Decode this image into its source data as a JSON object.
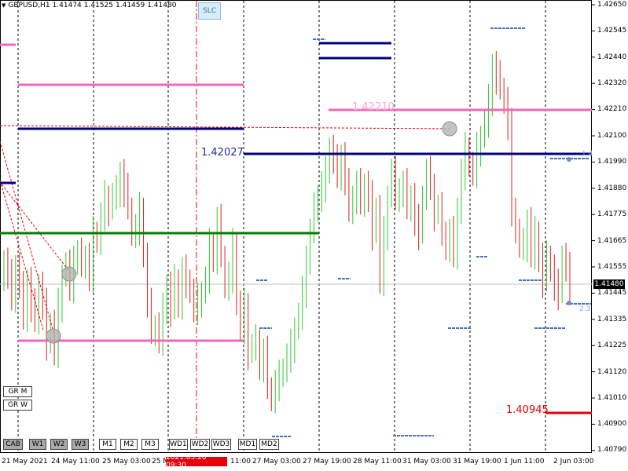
{
  "header": {
    "symbol": "GBPUSD,H1",
    "open": "1.41474",
    "high": "1.41525",
    "low": "1.41459",
    "close": "1.41480"
  },
  "slc_button": "SLC",
  "group_buttons": {
    "month": "GR M",
    "week": "GR W"
  },
  "timeframe_buttons": [
    "CAB",
    "W1",
    "W2",
    "W3",
    "M1",
    "M2",
    "M3",
    "WD1",
    "WD2",
    "WD3",
    "MD1",
    "MD2"
  ],
  "time_axis": {
    "labels": [
      "21 May 2021",
      "24 May 11:00",
      "25 May 03:00",
      "25 M",
      "11:00",
      "27 May 03:00",
      "27 May 19:00",
      "28 May 11:00",
      "31 May 03:00",
      "31 May 19:00",
      "1 Jun 11:00",
      "2 Jun 03:00"
    ],
    "cursor_time": "2021.05.26 09:30"
  },
  "price_axis": {
    "labels": [
      "1.42650",
      "1.42545",
      "1.42440",
      "1.42320",
      "1.42210",
      "1.42100",
      "1.41990",
      "1.41880",
      "1.41775",
      "1.41665",
      "1.41555",
      "1.41445",
      "1.41335",
      "1.41225",
      "1.41120",
      "1.41010",
      "1.40900",
      "1.40790"
    ],
    "current_price": "1.41480"
  },
  "levels": {
    "pink_label": "1.42210",
    "navy_label": "1.42027",
    "red_label": "1.40945",
    "small_1": "1.4",
    "small_2": "2.3"
  },
  "colors": {
    "bull": "#32c832",
    "bear": "#e0201e",
    "navy": "#000080",
    "pink": "#ee6ab4",
    "green": "#008000",
    "red": "#e8000b",
    "blue_dash": "#4a6fb5"
  },
  "chart_data": {
    "type": "candlestick",
    "symbol": "GBPUSD",
    "timeframe": "H1",
    "ylim": [
      1.4079,
      1.4265
    ],
    "grid": false,
    "closes": [
      1.4158,
      1.4152,
      1.4144,
      1.4156,
      1.4147,
      1.4135,
      1.415,
      1.414,
      1.4133,
      1.4148,
      1.414,
      1.4124,
      1.4132,
      1.412,
      1.414,
      1.4152,
      1.4156,
      1.4147,
      1.416,
      1.4161,
      1.4156,
      1.416,
      1.4152,
      1.417,
      1.4166,
      1.4177,
      1.4185,
      1.418,
      1.4185,
      1.4187,
      1.4195,
      1.4188,
      1.418,
      1.417,
      1.4172,
      1.418,
      1.416,
      1.414,
      1.413,
      1.4131,
      1.4124,
      1.4138,
      1.4148,
      1.4138,
      1.415,
      1.414,
      1.4154,
      1.415,
      1.4145,
      1.4138,
      1.4142,
      1.4145,
      1.415,
      1.4165,
      1.416,
      1.4175,
      1.416,
      1.4148,
      1.4152,
      1.4165,
      1.414,
      1.413,
      1.414,
      1.412,
      1.4122,
      1.4125,
      1.4115,
      1.412,
      1.4105,
      1.4101,
      1.4107,
      1.411,
      1.4113,
      1.4118,
      1.4123,
      1.413,
      1.4135,
      1.4145,
      1.416,
      1.417,
      1.418,
      1.4185,
      1.419,
      1.4195,
      1.4205,
      1.42,
      1.4195,
      1.4202,
      1.419,
      1.418,
      1.4185,
      1.419,
      1.4182,
      1.419,
      1.4185,
      1.417,
      1.418,
      1.415,
      1.417,
      1.4185,
      1.4195,
      1.4185,
      1.4188,
      1.419,
      1.418,
      1.4185,
      1.4175,
      1.417,
      1.4185,
      1.4195,
      1.419,
      1.4178,
      1.418,
      1.417,
      1.4165,
      1.417,
      1.416,
      1.418,
      1.4195,
      1.4205,
      1.4198,
      1.4195,
      1.4205,
      1.421,
      1.4215,
      1.4225,
      1.424,
      1.4235,
      1.423,
      1.4225,
      1.4215,
      1.418,
      1.417,
      1.4165,
      1.4165,
      1.4175,
      1.416,
      1.417,
      1.416,
      1.415,
      1.416,
      1.4155,
      1.4148,
      1.4145,
      1.416,
      1.4155,
      1.4148
    ]
  }
}
